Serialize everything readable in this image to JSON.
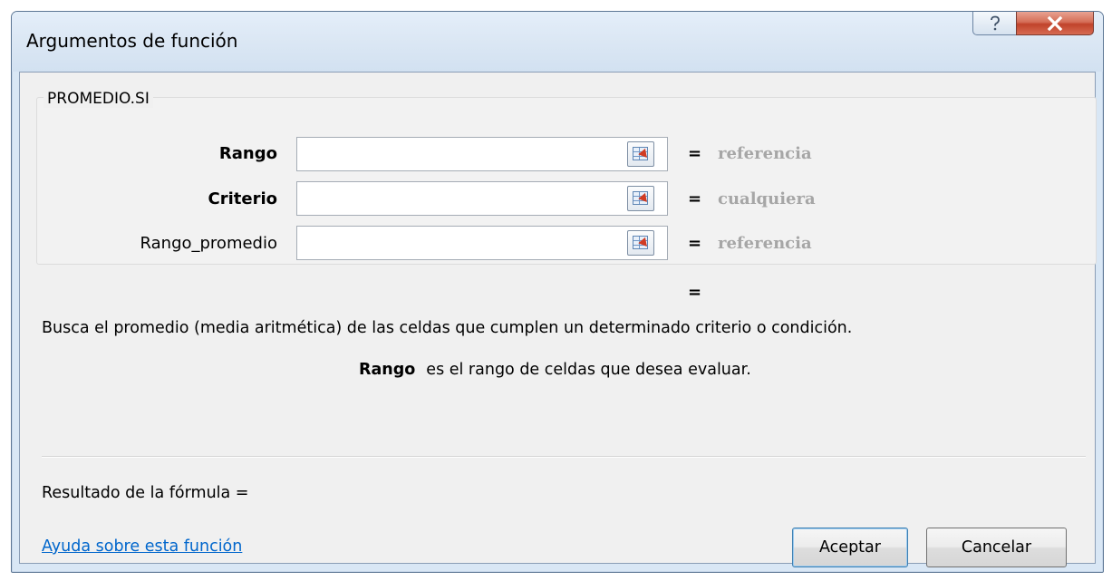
{
  "window": {
    "title": "Argumentos de función",
    "help_icon": "question-mark-icon",
    "close_icon": "close-x-icon"
  },
  "function_group": {
    "name": "PROMEDIO.SI",
    "arguments": [
      {
        "label": "Rango",
        "bold": true,
        "value": "",
        "result": "referencia"
      },
      {
        "label": "Criterio",
        "bold": true,
        "value": "",
        "result": "cualquiera"
      },
      {
        "label": "Rango_promedio",
        "bold": false,
        "value": "",
        "result": "referencia"
      }
    ],
    "equals_sign": "="
  },
  "result_equals": "=",
  "description": "Busca el promedio (media aritmética) de las celdas que cumplen un determinado criterio o condición.",
  "argument_help": {
    "name": "Rango",
    "text": "es el rango de celdas que desea evaluar."
  },
  "formula_result_label": "Resultado de la fórmula =",
  "help_link": "Ayuda sobre esta función",
  "buttons": {
    "ok": "Aceptar",
    "cancel": "Cancelar"
  },
  "colors": {
    "link": "#0066cc",
    "placeholder_value": "#a6a6a6",
    "close_button": "#c7513a",
    "frame": "#d9e7f5"
  }
}
